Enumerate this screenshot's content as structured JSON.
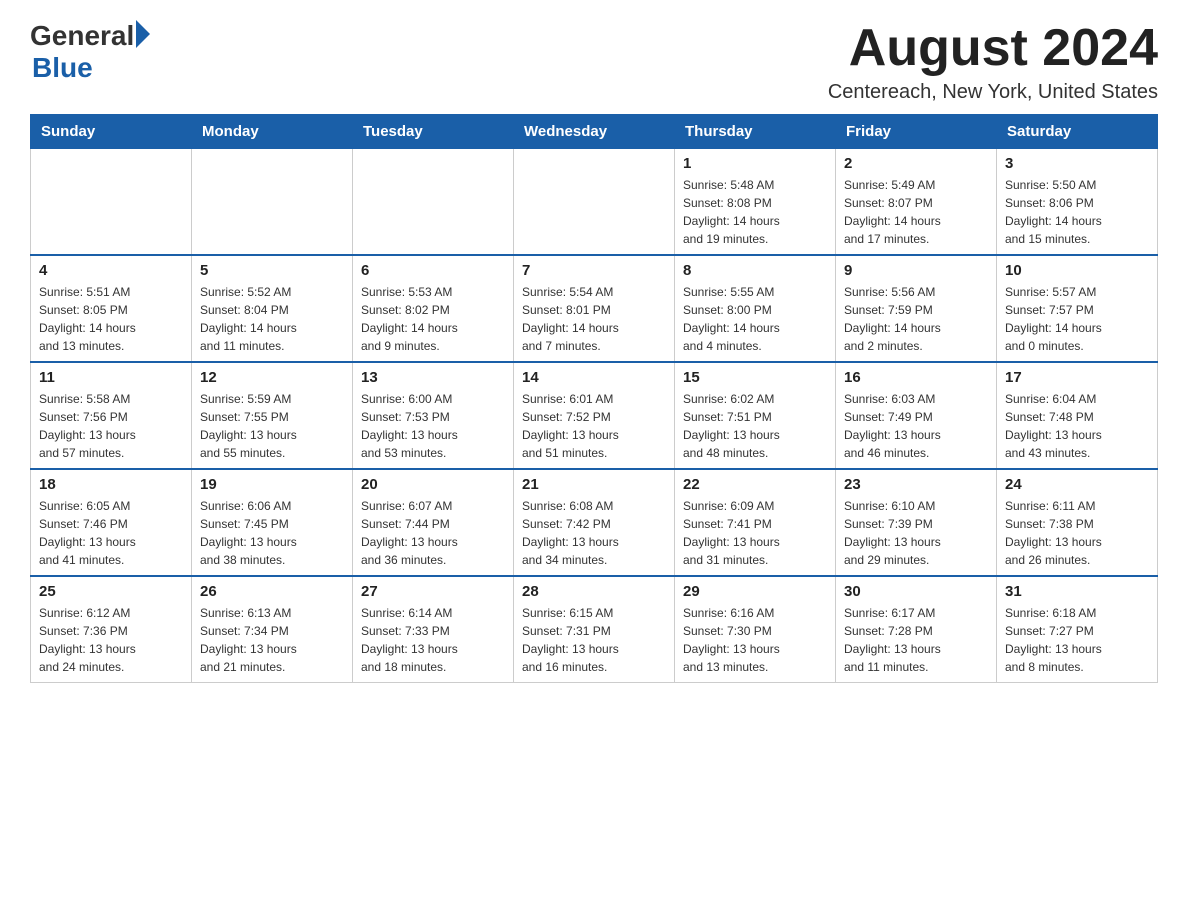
{
  "header": {
    "logo_general": "General",
    "logo_blue": "Blue",
    "title": "August 2024",
    "subtitle": "Centereach, New York, United States"
  },
  "weekdays": [
    "Sunday",
    "Monday",
    "Tuesday",
    "Wednesday",
    "Thursday",
    "Friday",
    "Saturday"
  ],
  "weeks": [
    [
      {
        "day": "",
        "info": ""
      },
      {
        "day": "",
        "info": ""
      },
      {
        "day": "",
        "info": ""
      },
      {
        "day": "",
        "info": ""
      },
      {
        "day": "1",
        "info": "Sunrise: 5:48 AM\nSunset: 8:08 PM\nDaylight: 14 hours\nand 19 minutes."
      },
      {
        "day": "2",
        "info": "Sunrise: 5:49 AM\nSunset: 8:07 PM\nDaylight: 14 hours\nand 17 minutes."
      },
      {
        "day": "3",
        "info": "Sunrise: 5:50 AM\nSunset: 8:06 PM\nDaylight: 14 hours\nand 15 minutes."
      }
    ],
    [
      {
        "day": "4",
        "info": "Sunrise: 5:51 AM\nSunset: 8:05 PM\nDaylight: 14 hours\nand 13 minutes."
      },
      {
        "day": "5",
        "info": "Sunrise: 5:52 AM\nSunset: 8:04 PM\nDaylight: 14 hours\nand 11 minutes."
      },
      {
        "day": "6",
        "info": "Sunrise: 5:53 AM\nSunset: 8:02 PM\nDaylight: 14 hours\nand 9 minutes."
      },
      {
        "day": "7",
        "info": "Sunrise: 5:54 AM\nSunset: 8:01 PM\nDaylight: 14 hours\nand 7 minutes."
      },
      {
        "day": "8",
        "info": "Sunrise: 5:55 AM\nSunset: 8:00 PM\nDaylight: 14 hours\nand 4 minutes."
      },
      {
        "day": "9",
        "info": "Sunrise: 5:56 AM\nSunset: 7:59 PM\nDaylight: 14 hours\nand 2 minutes."
      },
      {
        "day": "10",
        "info": "Sunrise: 5:57 AM\nSunset: 7:57 PM\nDaylight: 14 hours\nand 0 minutes."
      }
    ],
    [
      {
        "day": "11",
        "info": "Sunrise: 5:58 AM\nSunset: 7:56 PM\nDaylight: 13 hours\nand 57 minutes."
      },
      {
        "day": "12",
        "info": "Sunrise: 5:59 AM\nSunset: 7:55 PM\nDaylight: 13 hours\nand 55 minutes."
      },
      {
        "day": "13",
        "info": "Sunrise: 6:00 AM\nSunset: 7:53 PM\nDaylight: 13 hours\nand 53 minutes."
      },
      {
        "day": "14",
        "info": "Sunrise: 6:01 AM\nSunset: 7:52 PM\nDaylight: 13 hours\nand 51 minutes."
      },
      {
        "day": "15",
        "info": "Sunrise: 6:02 AM\nSunset: 7:51 PM\nDaylight: 13 hours\nand 48 minutes."
      },
      {
        "day": "16",
        "info": "Sunrise: 6:03 AM\nSunset: 7:49 PM\nDaylight: 13 hours\nand 46 minutes."
      },
      {
        "day": "17",
        "info": "Sunrise: 6:04 AM\nSunset: 7:48 PM\nDaylight: 13 hours\nand 43 minutes."
      }
    ],
    [
      {
        "day": "18",
        "info": "Sunrise: 6:05 AM\nSunset: 7:46 PM\nDaylight: 13 hours\nand 41 minutes."
      },
      {
        "day": "19",
        "info": "Sunrise: 6:06 AM\nSunset: 7:45 PM\nDaylight: 13 hours\nand 38 minutes."
      },
      {
        "day": "20",
        "info": "Sunrise: 6:07 AM\nSunset: 7:44 PM\nDaylight: 13 hours\nand 36 minutes."
      },
      {
        "day": "21",
        "info": "Sunrise: 6:08 AM\nSunset: 7:42 PM\nDaylight: 13 hours\nand 34 minutes."
      },
      {
        "day": "22",
        "info": "Sunrise: 6:09 AM\nSunset: 7:41 PM\nDaylight: 13 hours\nand 31 minutes."
      },
      {
        "day": "23",
        "info": "Sunrise: 6:10 AM\nSunset: 7:39 PM\nDaylight: 13 hours\nand 29 minutes."
      },
      {
        "day": "24",
        "info": "Sunrise: 6:11 AM\nSunset: 7:38 PM\nDaylight: 13 hours\nand 26 minutes."
      }
    ],
    [
      {
        "day": "25",
        "info": "Sunrise: 6:12 AM\nSunset: 7:36 PM\nDaylight: 13 hours\nand 24 minutes."
      },
      {
        "day": "26",
        "info": "Sunrise: 6:13 AM\nSunset: 7:34 PM\nDaylight: 13 hours\nand 21 minutes."
      },
      {
        "day": "27",
        "info": "Sunrise: 6:14 AM\nSunset: 7:33 PM\nDaylight: 13 hours\nand 18 minutes."
      },
      {
        "day": "28",
        "info": "Sunrise: 6:15 AM\nSunset: 7:31 PM\nDaylight: 13 hours\nand 16 minutes."
      },
      {
        "day": "29",
        "info": "Sunrise: 6:16 AM\nSunset: 7:30 PM\nDaylight: 13 hours\nand 13 minutes."
      },
      {
        "day": "30",
        "info": "Sunrise: 6:17 AM\nSunset: 7:28 PM\nDaylight: 13 hours\nand 11 minutes."
      },
      {
        "day": "31",
        "info": "Sunrise: 6:18 AM\nSunset: 7:27 PM\nDaylight: 13 hours\nand 8 minutes."
      }
    ]
  ]
}
